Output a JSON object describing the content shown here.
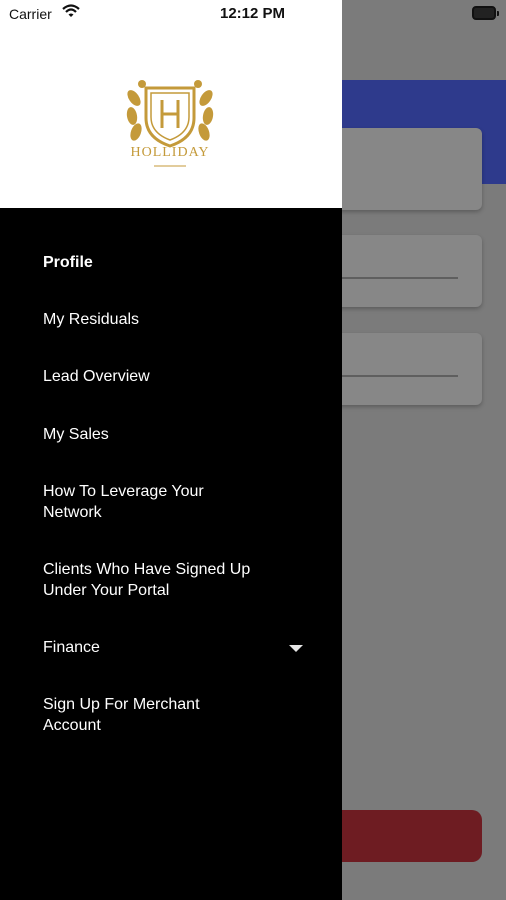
{
  "status_bar": {
    "carrier": "Carrier",
    "time": "12:12 PM"
  },
  "brand": {
    "logo_text": "HOLLIDAY"
  },
  "menu": {
    "items": [
      {
        "label": "Profile"
      },
      {
        "label": "My Residuals"
      },
      {
        "label": "Lead Overview"
      },
      {
        "label": "My Sales"
      },
      {
        "label": "How To Leverage Your Network"
      },
      {
        "label": "Clients Who Have Signed Up Under Your Portal"
      },
      {
        "label": "Finance"
      },
      {
        "label": "Sign Up For Merchant Account"
      }
    ]
  },
  "colors": {
    "drawer": "#000000",
    "gold": "#c49a3a",
    "header_blue": "#2e3a8c",
    "button_red": "#6e1c22"
  }
}
